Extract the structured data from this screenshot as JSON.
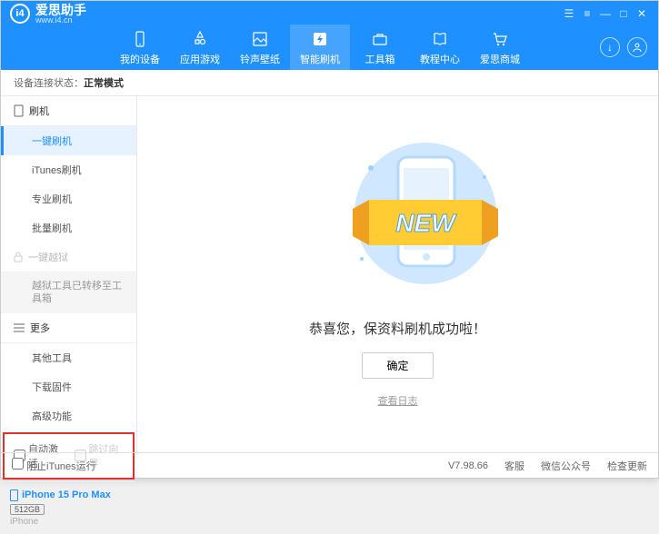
{
  "header": {
    "app_name": "爱思助手",
    "app_url": "www.i4.cn",
    "menu": [
      {
        "label": "我的设备"
      },
      {
        "label": "应用游戏"
      },
      {
        "label": "铃声壁纸"
      },
      {
        "label": "智能刷机"
      },
      {
        "label": "工具箱"
      },
      {
        "label": "教程中心"
      },
      {
        "label": "爱思商城"
      }
    ]
  },
  "status": {
    "prefix": "设备连接状态：",
    "value": "正常模式"
  },
  "sidebar": {
    "flash": {
      "title": "刷机",
      "items": [
        "一键刷机",
        "iTunes刷机",
        "专业刷机",
        "批量刷机"
      ]
    },
    "jailbreak": {
      "title": "一键越狱",
      "note": "越狱工具已转移至工具箱"
    },
    "more": {
      "title": "更多",
      "items": [
        "其他工具",
        "下载固件",
        "高级功能"
      ]
    },
    "checks": {
      "auto_activate": "自动激活",
      "skip_guide": "跳过向导"
    },
    "device": {
      "name": "iPhone 15 Pro Max",
      "storage": "512GB",
      "type": "iPhone"
    }
  },
  "main": {
    "new_badge": "NEW",
    "success_msg": "恭喜您，保资料刷机成功啦！",
    "ok_btn": "确定",
    "view_log": "查看日志"
  },
  "footer": {
    "block_itunes": "阻止iTunes运行",
    "version": "V7.98.66",
    "links": [
      "客服",
      "微信公众号",
      "检查更新"
    ]
  }
}
